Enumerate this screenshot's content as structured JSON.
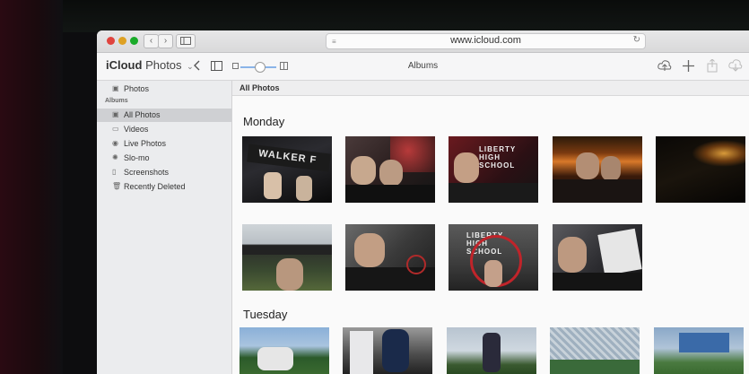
{
  "browser": {
    "url": "www.icloud.com",
    "back_glyph": "‹",
    "forward_glyph": "›",
    "reload_glyph": "↻"
  },
  "toolbar": {
    "app_name": "iCloud",
    "app_section": "Photos",
    "title": "Albums",
    "icons": [
      "back-chevron-icon",
      "sidebar-toggle-icon",
      "zoom-slider",
      "upload-icon",
      "add-icon",
      "share-icon",
      "download-icon"
    ]
  },
  "sidebar": {
    "header": "Albums",
    "items": [
      {
        "label": "Photos",
        "icon": "photos-icon"
      },
      {
        "label": "All Photos",
        "icon": "all-photos-icon",
        "selected": true
      },
      {
        "label": "Videos",
        "icon": "video-icon"
      },
      {
        "label": "Live Photos",
        "icon": "live-photo-icon"
      },
      {
        "label": "Slo-mo",
        "icon": "slo-mo-icon"
      },
      {
        "label": "Screenshots",
        "icon": "screenshot-icon"
      },
      {
        "label": "Recently Deleted",
        "icon": "trash-icon"
      }
    ]
  },
  "content": {
    "header": "All Photos",
    "sections": [
      {
        "title": "Monday"
      },
      {
        "title": "Tuesday"
      }
    ],
    "photo_captions": {
      "m1": "WALKER F",
      "m3": "LIBERTY HIGH SCHOOL",
      "m8": "LIBERTY HIGH SCHOOL"
    }
  },
  "colors": {
    "accent": "#8ab4e8",
    "close": "#e0443e",
    "minimize": "#dea123",
    "maximize": "#1aab29",
    "graffiti_red": "#c0242a"
  }
}
